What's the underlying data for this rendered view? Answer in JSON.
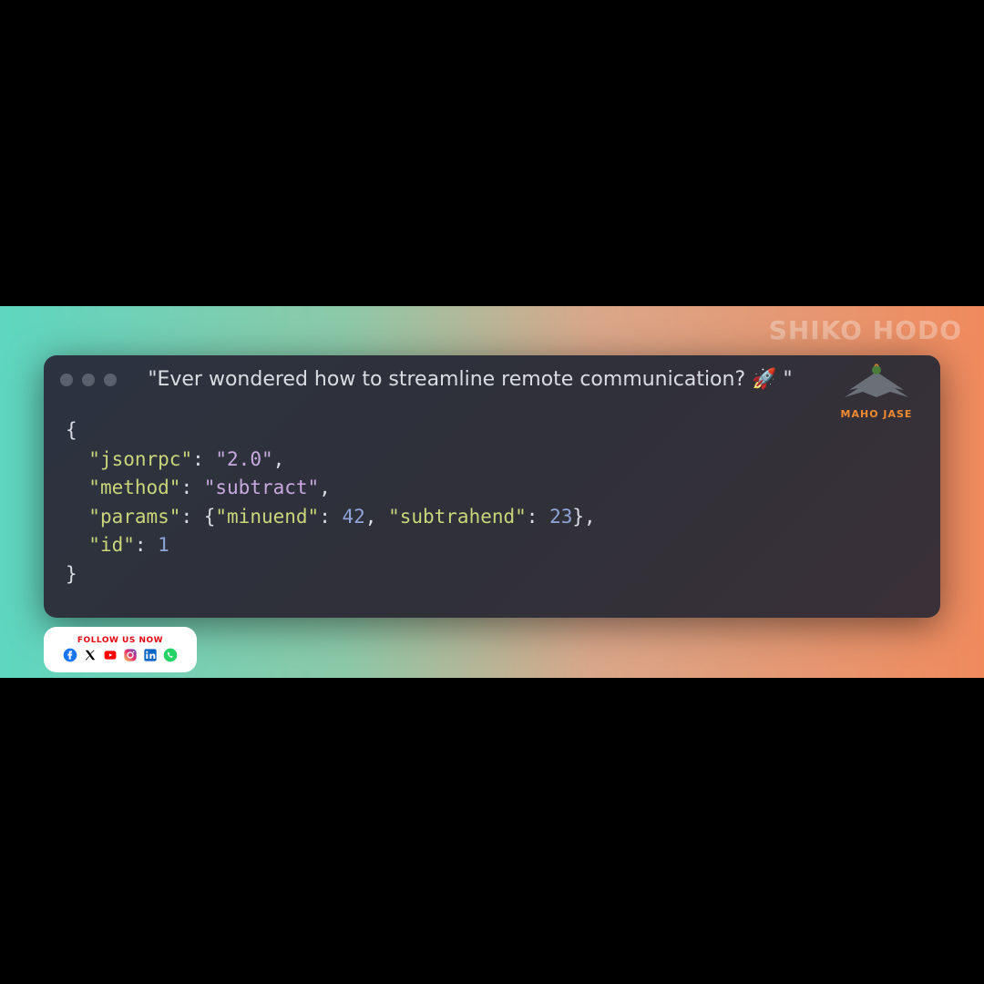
{
  "watermark": "SHIKO HODO",
  "window": {
    "title": "\"Ever wondered how to streamline remote communication? 🚀 \""
  },
  "logo": {
    "text": "MAHO JASE"
  },
  "code": {
    "jsonrpc_key": "\"jsonrpc\"",
    "jsonrpc_val": "\"2.0\"",
    "method_key": "\"method\"",
    "method_val": "\"subtract\"",
    "params_key": "\"params\"",
    "minuend_key": "\"minuend\"",
    "minuend_val": "42",
    "subtrahend_key": "\"subtrahend\"",
    "subtrahend_val": "23",
    "id_key": "\"id\"",
    "id_val": "1"
  },
  "social": {
    "title": "FOLLOW US NOW",
    "icons": [
      "facebook",
      "x-twitter",
      "youtube",
      "instagram",
      "linkedin",
      "whatsapp"
    ]
  },
  "colors": {
    "key": "#c9d67a",
    "string": "#c9a9e0",
    "number": "#8fa5d9",
    "bg": "#2c3340"
  }
}
